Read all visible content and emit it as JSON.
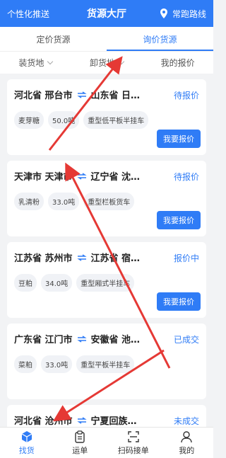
{
  "header": {
    "left_label": "个性化推送",
    "title": "货源大厅",
    "right_label": "常跑路线",
    "right_icon": "location-pin-icon"
  },
  "tabs": [
    {
      "label": "定价货源",
      "active": false
    },
    {
      "label": "询价货源",
      "active": true
    }
  ],
  "filters": [
    {
      "label": "装货地"
    },
    {
      "label": "卸货地"
    },
    {
      "label": "我的报价"
    }
  ],
  "cards": [
    {
      "from": "河北省 邢台市",
      "to": "山东省 日…",
      "status": "待报价",
      "tags": [
        "麦芽糖",
        "50.0吨",
        "重型低平板半挂车"
      ],
      "button": "我要报价"
    },
    {
      "from": "天津市 天津市",
      "to": "辽宁省 沈…",
      "status": "待报价",
      "tags": [
        "乳清粉",
        "33.0吨",
        "重型栏板货车"
      ],
      "button": "我要报价"
    },
    {
      "from": "江苏省 苏州市",
      "to": "江苏省 宿…",
      "status": "报价中",
      "tags": [
        "豆粕",
        "34.0吨",
        "重型厢式半挂车"
      ],
      "button": "我要报价"
    },
    {
      "from": "广东省 江门市",
      "to": "安徽省 池…",
      "status": "已成交",
      "tags": [
        "菜粕",
        "33.0吨",
        "重型平板半挂车"
      ]
    },
    {
      "from": "河北省 沧州市",
      "to": "宁夏回族…",
      "status": "未成交",
      "tags": []
    }
  ],
  "bottom_nav": [
    {
      "label": "找货",
      "icon": "box-icon",
      "active": true
    },
    {
      "label": "运单",
      "icon": "clipboard-icon",
      "active": false
    },
    {
      "label": "扫码接单",
      "icon": "scan-icon",
      "active": false
    },
    {
      "label": "我的",
      "icon": "user-icon",
      "active": false
    }
  ],
  "colors": {
    "accent": "#2f7cf6",
    "annotation": "#e53935"
  }
}
